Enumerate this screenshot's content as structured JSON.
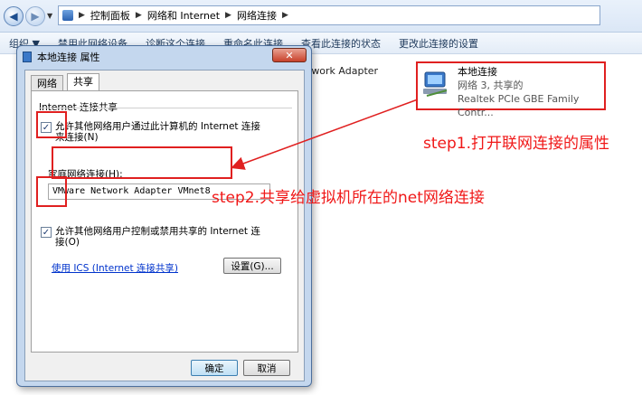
{
  "address_bar": {
    "breadcrumbs": [
      "控制面板",
      "网络和 Internet",
      "网络连接"
    ]
  },
  "command_bar": {
    "items": [
      "组织 ▼",
      "禁用此网络设备",
      "诊断这个连接",
      "重命名此连接",
      "查看此连接的状态",
      "更改此连接的设置"
    ]
  },
  "content": {
    "partial_adapter_text": "twork Adapter",
    "adapter": {
      "name": "本地连接",
      "status": "网络 3, 共享的",
      "device": "Realtek PCIe GBE Family Contr..."
    }
  },
  "dialog": {
    "title": "本地连接 属性",
    "close_label": "✕",
    "tabs": [
      "网络",
      "共享"
    ],
    "group_title": "Internet 连接共享",
    "allow_share_line1": "允许其他网络用户通过此计算机的 Internet 连接",
    "allow_share_line2": "来连接(N)",
    "home_network_label": "家庭网络连接(H):",
    "home_network_value": "VMware Network Adapter VMnet8",
    "allow_control_line1": "允许其他网络用户控制或禁用共享的 Internet 连",
    "allow_control_line2": "接(O)",
    "ics_link": "使用 ICS (Internet 连接共享)",
    "settings_button": "设置(G)...",
    "ok_button": "确定",
    "cancel_button": "取消"
  },
  "annotations": {
    "step1": "step1.打开联网连接的属性",
    "step2": "step2.共享给虚拟机所在的net网络连接"
  },
  "colors": {
    "annotation_red": "#e02020",
    "link_blue": "#0033cc"
  }
}
